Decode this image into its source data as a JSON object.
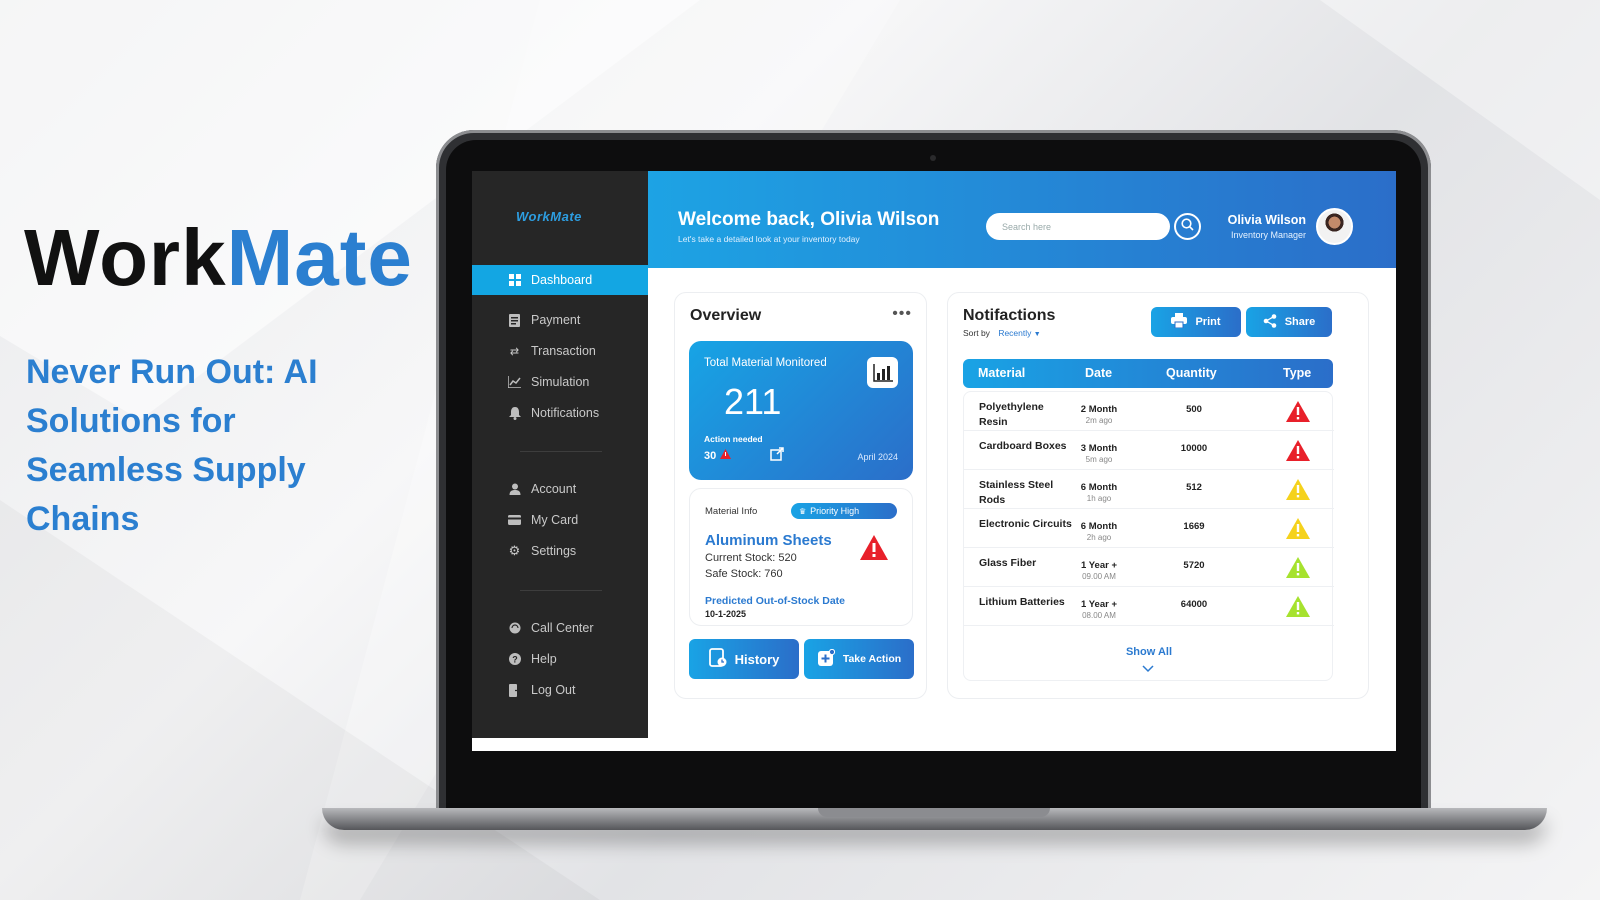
{
  "brand": {
    "part1": "Work",
    "part2": "Mate"
  },
  "tagline": "Never Run Out: AI Solutions for Seamless Supply Chains",
  "app": {
    "logo": "WorkMate",
    "nav_main": [
      {
        "label": "Dashboard",
        "icon": "dashboard-icon"
      },
      {
        "label": "Payment",
        "icon": "payment-icon"
      },
      {
        "label": "Transaction",
        "icon": "transaction-icon"
      },
      {
        "label": "Simulation",
        "icon": "simulation-icon"
      },
      {
        "label": "Notifications",
        "icon": "bell-icon"
      }
    ],
    "nav_account": [
      {
        "label": "Account",
        "icon": "user-icon"
      },
      {
        "label": "My Card",
        "icon": "card-icon"
      },
      {
        "label": "Settings",
        "icon": "gear-icon"
      }
    ],
    "nav_support": [
      {
        "label": "Call Center",
        "icon": "headset-icon"
      },
      {
        "label": "Help",
        "icon": "help-icon"
      },
      {
        "label": "Log Out",
        "icon": "logout-icon"
      }
    ],
    "header": {
      "welcome": "Welcome back, Olivia Wilson",
      "subtitle": "Let's take a detailed look at your inventory today",
      "search_placeholder": "Search here",
      "user_name": "Olivia Wilson",
      "user_role": "Inventory Manager"
    },
    "overview": {
      "title": "Overview",
      "total_label": "Total Material Monitored",
      "total_value": "211",
      "action_label": "Action needed",
      "action_count": "30",
      "date": "April 2024",
      "material_info_label": "Material Info",
      "priority": "Priority High",
      "material_name": "Aluminum Sheets",
      "current_stock": "Current Stock: 520",
      "safe_stock": "Safe Stock: 760",
      "predicted_label": "Predicted Out-of-Stock Date",
      "predicted_date": "10-1-2025",
      "history_button": "History",
      "take_action_button": "Take Action"
    },
    "notifications": {
      "title": "Notifactions",
      "sort_by": "Sort by",
      "sort_value": "Recently",
      "print_button": "Print",
      "share_button": "Share",
      "columns": [
        "Material",
        "Date",
        "Quantity",
        "Type"
      ],
      "rows": [
        {
          "material": "Polyethylene Resin",
          "date": "2 Month",
          "ago": "2m ago",
          "quantity": "500",
          "type_color": "#e8202a"
        },
        {
          "material": "Cardboard Boxes",
          "date": "3 Month",
          "ago": "5m ago",
          "quantity": "10000",
          "type_color": "#e8202a"
        },
        {
          "material": "Stainless Steel Rods",
          "date": "6 Month",
          "ago": "1h ago",
          "quantity": "512",
          "type_color": "#f5d21c"
        },
        {
          "material": "Electronic Circuits",
          "date": "6 Month",
          "ago": "2h ago",
          "quantity": "1669",
          "type_color": "#f5d21c"
        },
        {
          "material": "Glass Fiber",
          "date": "1 Year +",
          "ago": "09.00 AM",
          "quantity": "5720",
          "type_color": "#a6e22e"
        },
        {
          "material": "Lithium Batteries",
          "date": "1 Year +",
          "ago": "08.00 AM",
          "quantity": "64000",
          "type_color": "#a6e22e"
        }
      ],
      "show_all": "Show All"
    }
  }
}
